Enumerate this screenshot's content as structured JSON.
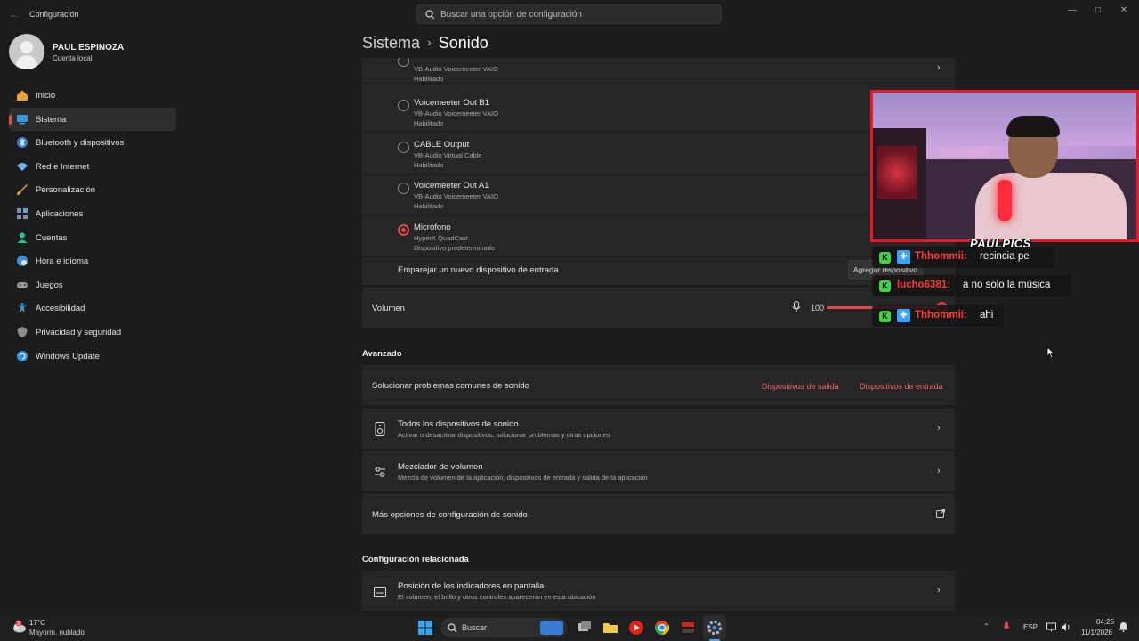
{
  "window": {
    "title": "Configuración",
    "search_placeholder": "Buscar una opción de configuración"
  },
  "profile": {
    "name": "PAUL ESPINOZA",
    "account_type": "Cuenta local"
  },
  "sidebar": {
    "items": [
      {
        "label": "Inicio",
        "icon": "home-icon",
        "color": "#e8a33c"
      },
      {
        "label": "Sistema",
        "icon": "system-icon",
        "color": "#3a9ae0",
        "active": true
      },
      {
        "label": "Bluetooth y dispositivos",
        "icon": "bluetooth-icon",
        "color": "#3a7fe0"
      },
      {
        "label": "Red e Internet",
        "icon": "wifi-icon",
        "color": "#6fb5ef"
      },
      {
        "label": "Personalización",
        "icon": "brush-icon",
        "color": "#e99b3c"
      },
      {
        "label": "Aplicaciones",
        "icon": "apps-icon",
        "color": "#7c8ea8"
      },
      {
        "label": "Cuentas",
        "icon": "person-icon",
        "color": "#2fbf8e"
      },
      {
        "label": "Hora e idioma",
        "icon": "globe-icon",
        "color": "#3a8fe0"
      },
      {
        "label": "Juegos",
        "icon": "gamepad-icon",
        "color": "#9a9a9a"
      },
      {
        "label": "Accesibilidad",
        "icon": "accessibility-icon",
        "color": "#3a9ae0"
      },
      {
        "label": "Privacidad y seguridad",
        "icon": "shield-icon",
        "color": "#8c8c8c"
      },
      {
        "label": "Windows Update",
        "icon": "update-icon",
        "color": "#2f8fe0"
      }
    ]
  },
  "breadcrumb": {
    "parent": "Sistema",
    "separator": "›",
    "current": "Sonido"
  },
  "input_devices": [
    {
      "name": "",
      "subtitle": "VB-Audio Voicemeeter VAIO",
      "status": "Habilitado",
      "selected": false,
      "partial": true
    },
    {
      "name": "Voicemeeter Out B1",
      "subtitle": "VB-Audio Voicemeeter VAIO",
      "status": "Habilitado",
      "selected": false
    },
    {
      "name": "CABLE Output",
      "subtitle": "VB-Audio Virtual Cable",
      "status": "Habilitado",
      "selected": false
    },
    {
      "name": "Voicemeeter Out A1",
      "subtitle": "VB-Audio Voicemeeter VAIO",
      "status": "Habilitado",
      "selected": false
    },
    {
      "name": "Micrófono",
      "subtitle": "HyperX QuadCast",
      "status": "Dispositivo predeterminado",
      "selected": true
    }
  ],
  "pair": {
    "label": "Emparejar un nuevo dispositivo de entrada",
    "button": "Agregar dispositivo"
  },
  "volume": {
    "label": "Volumen",
    "value": "100",
    "level": 1.0
  },
  "advanced": {
    "heading": "Avanzado",
    "troubleshoot": {
      "label": "Solucionar problemas comunes de sonido",
      "link_output": "Dispositivos de salida",
      "link_input": "Dispositivos de entrada"
    },
    "all_devices": {
      "title": "Todos los dispositivos de sonido",
      "desc": "Activar o desactivar dispositivos, solucionar problemas y otras opciones"
    },
    "mixer": {
      "title": "Mezclador de volumen",
      "desc": "Mezcla de volumen de la aplicación, dispositivos de entrada y salida de la aplicación"
    },
    "more_options": "Más opciones de configuración de sonido"
  },
  "related": {
    "heading": "Configuración relacionada",
    "indicator": {
      "title": "Posición de los indicadores en pantalla",
      "desc": "El volumen, el brillo y otros controles aparecerán en esta ubicación"
    }
  },
  "stream_overlay": {
    "brand": "PAULPICS",
    "chat": [
      {
        "user": "Thhommii:",
        "message": "recincia pe"
      },
      {
        "user": "lucho6381:",
        "message": "a no solo la música"
      },
      {
        "user": "Thhommii:",
        "message": "ahi"
      }
    ]
  },
  "taskbar": {
    "weather_temp": "17°C",
    "weather_desc": "Mayorm. nublado",
    "weather_badge": "1",
    "search_label": "Buscar",
    "language": "ESP",
    "time": "04:25",
    "date": "11/1/2026"
  }
}
